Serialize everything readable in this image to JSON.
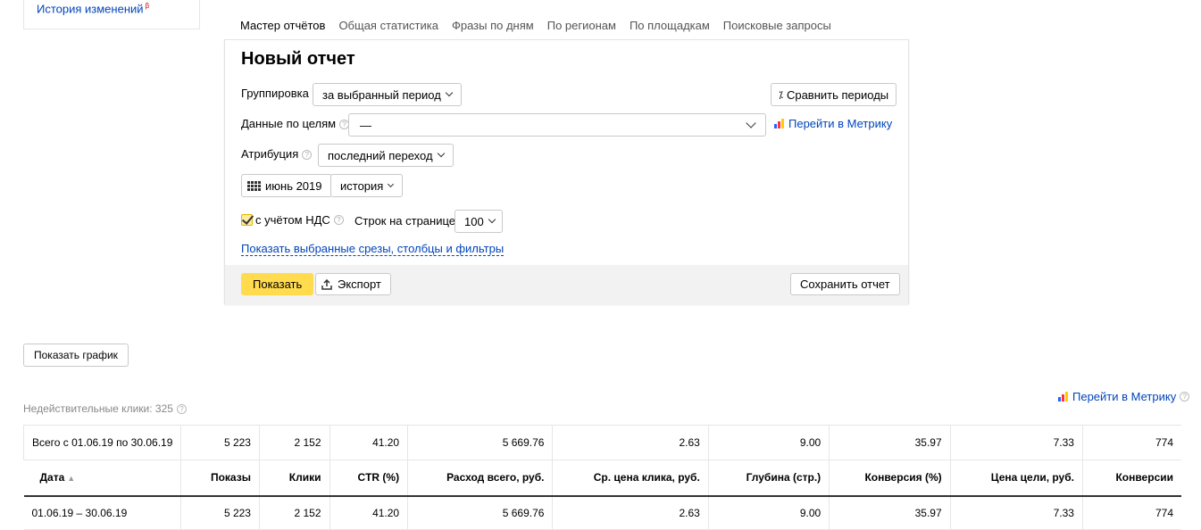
{
  "history": {
    "label": "История изменений",
    "beta": "β"
  },
  "tabs": [
    "Мастер отчётов",
    "Общая статистика",
    "Фразы по дням",
    "По регионам",
    "По площадкам",
    "Поисковые запросы"
  ],
  "report": {
    "title": "Новый отчет",
    "grouping_label": "Группировка",
    "grouping_value": "за выбранный период",
    "compare_button": "Сравнить периоды",
    "goals_label": "Данные по целям",
    "goals_value": "—",
    "metrika_link": "Перейти в Метрику",
    "attribution_label": "Атрибуция",
    "attribution_value": "последний переход",
    "period_value": "июнь 2019",
    "history_select": "история",
    "vat_label": "с учётом НДС",
    "rows_label": "Строк на странице",
    "rows_value": "100",
    "show_filters_link": "Показать выбранные срезы, столбцы и фильтры",
    "show_button": "Показать",
    "export_button": "Экспорт",
    "save_button": "Сохранить отчет"
  },
  "show_chart_button": "Показать график",
  "invalid_clicks": "Недействительные клики: 325",
  "metrika_link_bottom": "Перейти в Метрику",
  "table": {
    "total": [
      "Всего с 01.06.19 по 30.06.19",
      "5 223",
      "2 152",
      "41.20",
      "5 669.76",
      "2.63",
      "9.00",
      "35.97",
      "7.33",
      "774"
    ],
    "headers": [
      "Дата",
      "Показы",
      "Клики",
      "CTR (%)",
      "Расход всего, руб.",
      "Ср. цена клика, руб.",
      "Глубина (стр.)",
      "Конверсия (%)",
      "Цена цели, руб.",
      "Конверсии"
    ],
    "sort_arrow": "▲",
    "rows": [
      [
        "01.06.19 – 30.06.19",
        "5 223",
        "2 152",
        "41.20",
        "5 669.76",
        "2.63",
        "9.00",
        "35.97",
        "7.33",
        "774"
      ]
    ]
  },
  "colors": {
    "accent_tab": "#e52b1e",
    "link": "#0044bb",
    "primary_button": "#ffdb4d"
  }
}
